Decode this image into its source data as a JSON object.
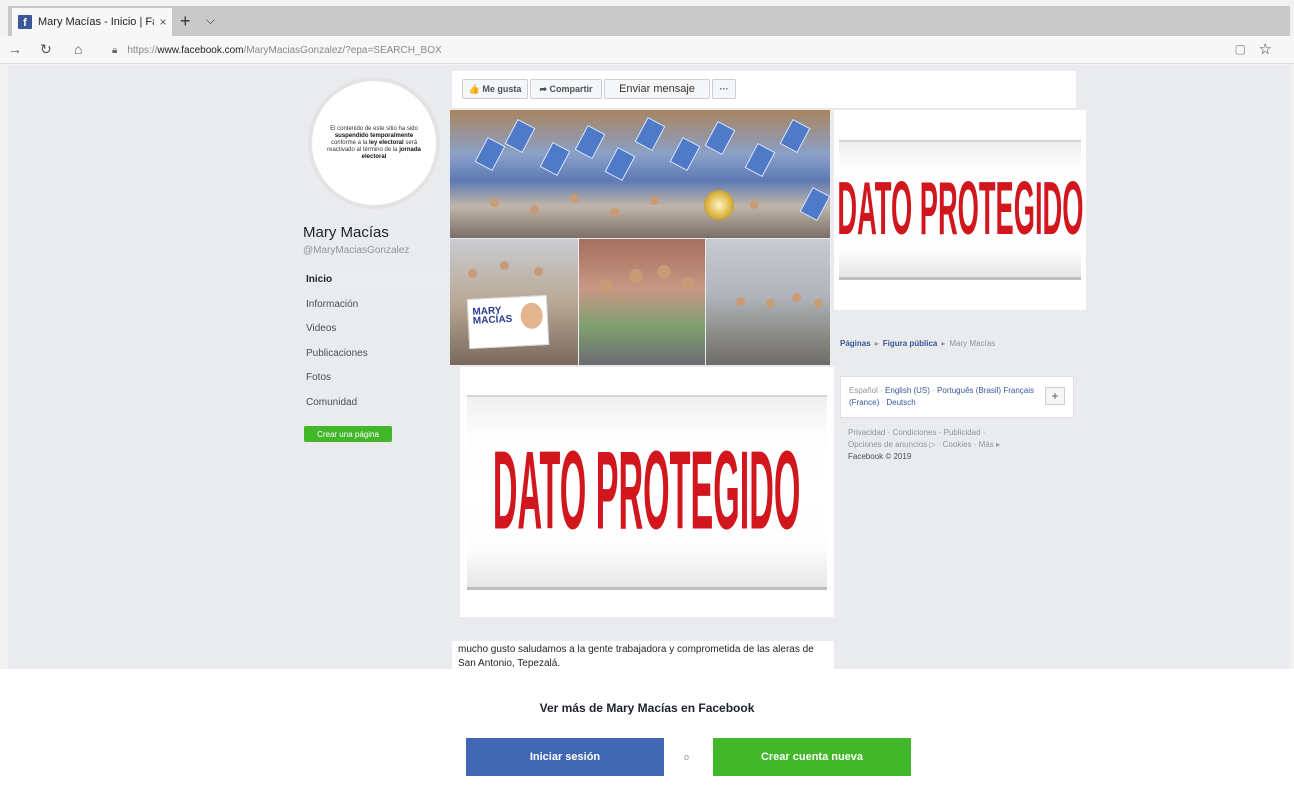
{
  "browser": {
    "tab_title": "Mary Macías - Inicio | Fa",
    "tab_close": "×",
    "new_tab": "+",
    "tab_menu": "⌵",
    "back": "→",
    "refresh": "↻",
    "home": "⌂",
    "url_scheme": "https://",
    "url_host": "www.facebook.com",
    "url_path": "/MaryMaciasGonzalez/?epa=SEARCH_BOX",
    "reading_view": "▢",
    "favorite": "☆"
  },
  "profile": {
    "avatar_text_1": "El contenido de este sitio ha sido",
    "avatar_text_bold_1": "suspendido temporalmente",
    "avatar_text_2": "conforme a la",
    "avatar_text_bold_2": "ley electoral",
    "avatar_text_3": "será reactivado al término de la",
    "avatar_text_bold_3": "jornada electoral",
    "name": "Mary Macías",
    "handle": "@MaryMaciasGonzalez"
  },
  "sidebar": {
    "items": [
      {
        "label": "Inicio"
      },
      {
        "label": "Información"
      },
      {
        "label": "Videos"
      },
      {
        "label": "Publicaciones"
      },
      {
        "label": "Fotos"
      },
      {
        "label": "Comunidad"
      }
    ],
    "create_page": "Crear una página"
  },
  "actions": {
    "like": "👍 Me gusta",
    "share": "➦ Compartir",
    "message": "Enviar mensaje",
    "more": "···"
  },
  "photos": {
    "sign_text": "MARY MACÍAS"
  },
  "protected_label": "DATO PROTEGIDO",
  "post": {
    "text": "mucho gusto saludamos a la gente trabajadora y comprometida de las aleras de San Antonio, Tepezalá."
  },
  "breadcrumb": {
    "item1": "Páginas",
    "item2": "Figura pública",
    "item3": "Mary Macías",
    "sep": "▸"
  },
  "languages": {
    "current": "Español",
    "options": [
      "English (US)",
      "Português (Brasil)",
      "Français (France)",
      "Deutsch"
    ],
    "plus": "+"
  },
  "footer": {
    "line1": "Privacidad · Condiciones · Publicidad ·",
    "line2": "Opciones de anuncios ▷ · Cookies · Más ▸",
    "copyright": "Facebook © 2019"
  },
  "login_prompt": {
    "title": "Ver más de Mary Macías en Facebook",
    "login": "Iniciar sesión",
    "or": "o",
    "create": "Crear cuenta nueva"
  },
  "colors": {
    "facebook_blue": "#4267b2",
    "facebook_green": "#42b72a",
    "protected_red": "#d2161e"
  }
}
